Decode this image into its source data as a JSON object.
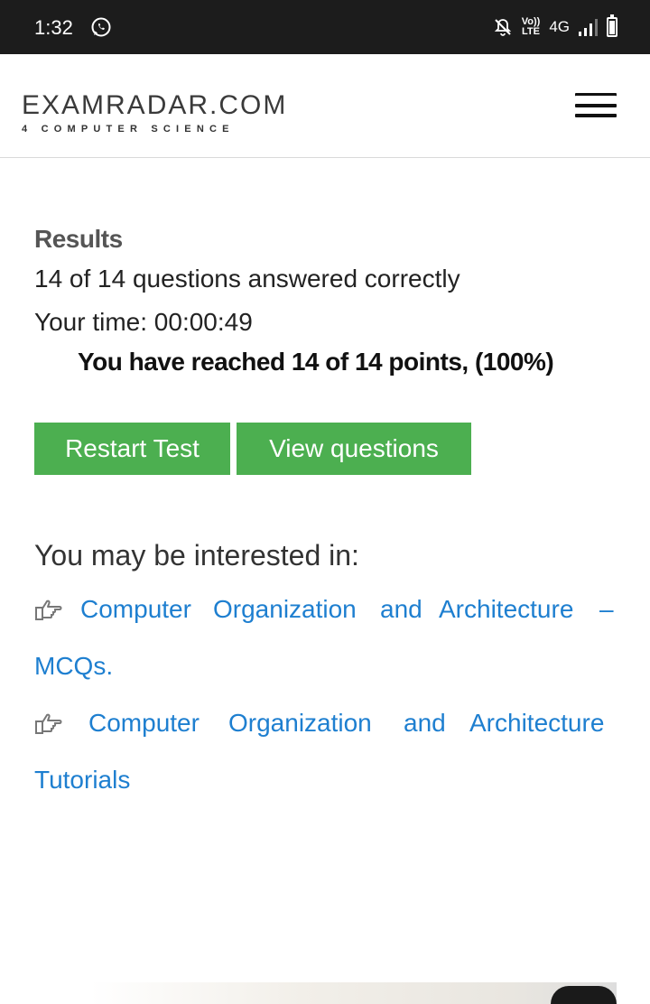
{
  "status_bar": {
    "time": "1:32",
    "network_label": "4G",
    "volte_top": "Vo))",
    "volte_bottom": "LTE",
    "icons": [
      "whatsapp-icon",
      "mute-notifications-icon",
      "volte-icon",
      "signal-icon",
      "battery-icon"
    ]
  },
  "header": {
    "logo_main": "EXAMRADAR.COM",
    "logo_sub": "4 COMPUTER SCIENCE",
    "menu_icon": "hamburger-menu-icon"
  },
  "results": {
    "title": "Results",
    "answered": "14 of 14 questions answered correctly",
    "time": "Your time: 00:00:49",
    "points": "You have reached 14 of 14 points, (100%)"
  },
  "buttons": {
    "restart": "Restart Test",
    "view": "View questions"
  },
  "interested": {
    "heading": "You may be interested in:",
    "links": [
      {
        "line1": [
          "Computer",
          "Organization",
          "and",
          "Architecture",
          "–"
        ],
        "line2": "MCQs.",
        "icon": "hand-pointing-right-icon"
      },
      {
        "line1": [
          "Computer",
          "Organization",
          "and",
          "Architecture"
        ],
        "line2": "Tutorials",
        "icon": "hand-pointing-right-icon"
      }
    ]
  },
  "colors": {
    "status_bar_bg": "#1c1c1c",
    "button_green": "#4caf50",
    "link_blue": "#1e7fd0"
  }
}
